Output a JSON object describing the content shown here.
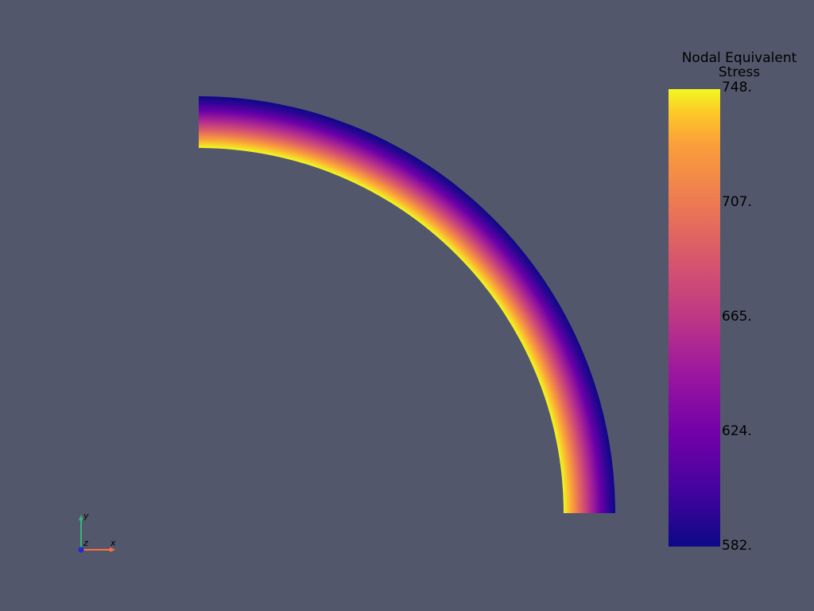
{
  "scalar_bar": {
    "title_line1": "Nodal Equivalent",
    "title_line2": "Stress",
    "labels": [
      "748.",
      "707.",
      "665.",
      "624.",
      "582."
    ],
    "colormap": "plasma"
  },
  "axes": {
    "x_label": "x",
    "y_label": "y",
    "z_label": "z",
    "x_color": "#ff6f3c",
    "y_color": "#3bb37e",
    "z_color": "#1f2cd0"
  },
  "background_color": "#52576b"
}
